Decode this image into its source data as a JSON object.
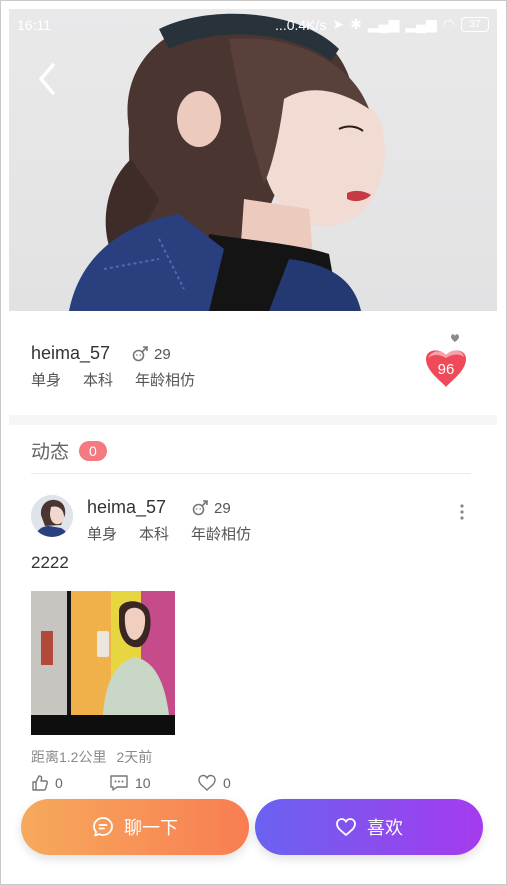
{
  "status_bar": {
    "time": "16:11",
    "network_speed": "...0.4K/s",
    "battery": "37"
  },
  "profile": {
    "username": "heima_57",
    "gender_icon": "male-icon",
    "age": "29",
    "tags": [
      "单身",
      "本科",
      "年龄相仿"
    ],
    "match_score": "96"
  },
  "feed": {
    "title": "动态",
    "count": "0",
    "post": {
      "username": "heima_57",
      "age": "29",
      "tags": [
        "单身",
        "本科",
        "年龄相仿"
      ],
      "text": "2222",
      "distance": "距离1.2公里",
      "time_ago": "2天前",
      "likes": "0",
      "comments": "10",
      "favorites": "0"
    }
  },
  "actions": {
    "chat_label": "聊一下",
    "like_label": "喜欢"
  },
  "colors": {
    "chat_gradient_start": "#f6aa5c",
    "chat_gradient_end": "#f97d52",
    "like_gradient_start": "#6a62f0",
    "like_gradient_end": "#a53bed",
    "badge": "#f27a80",
    "heart": "#ef4a5a"
  }
}
